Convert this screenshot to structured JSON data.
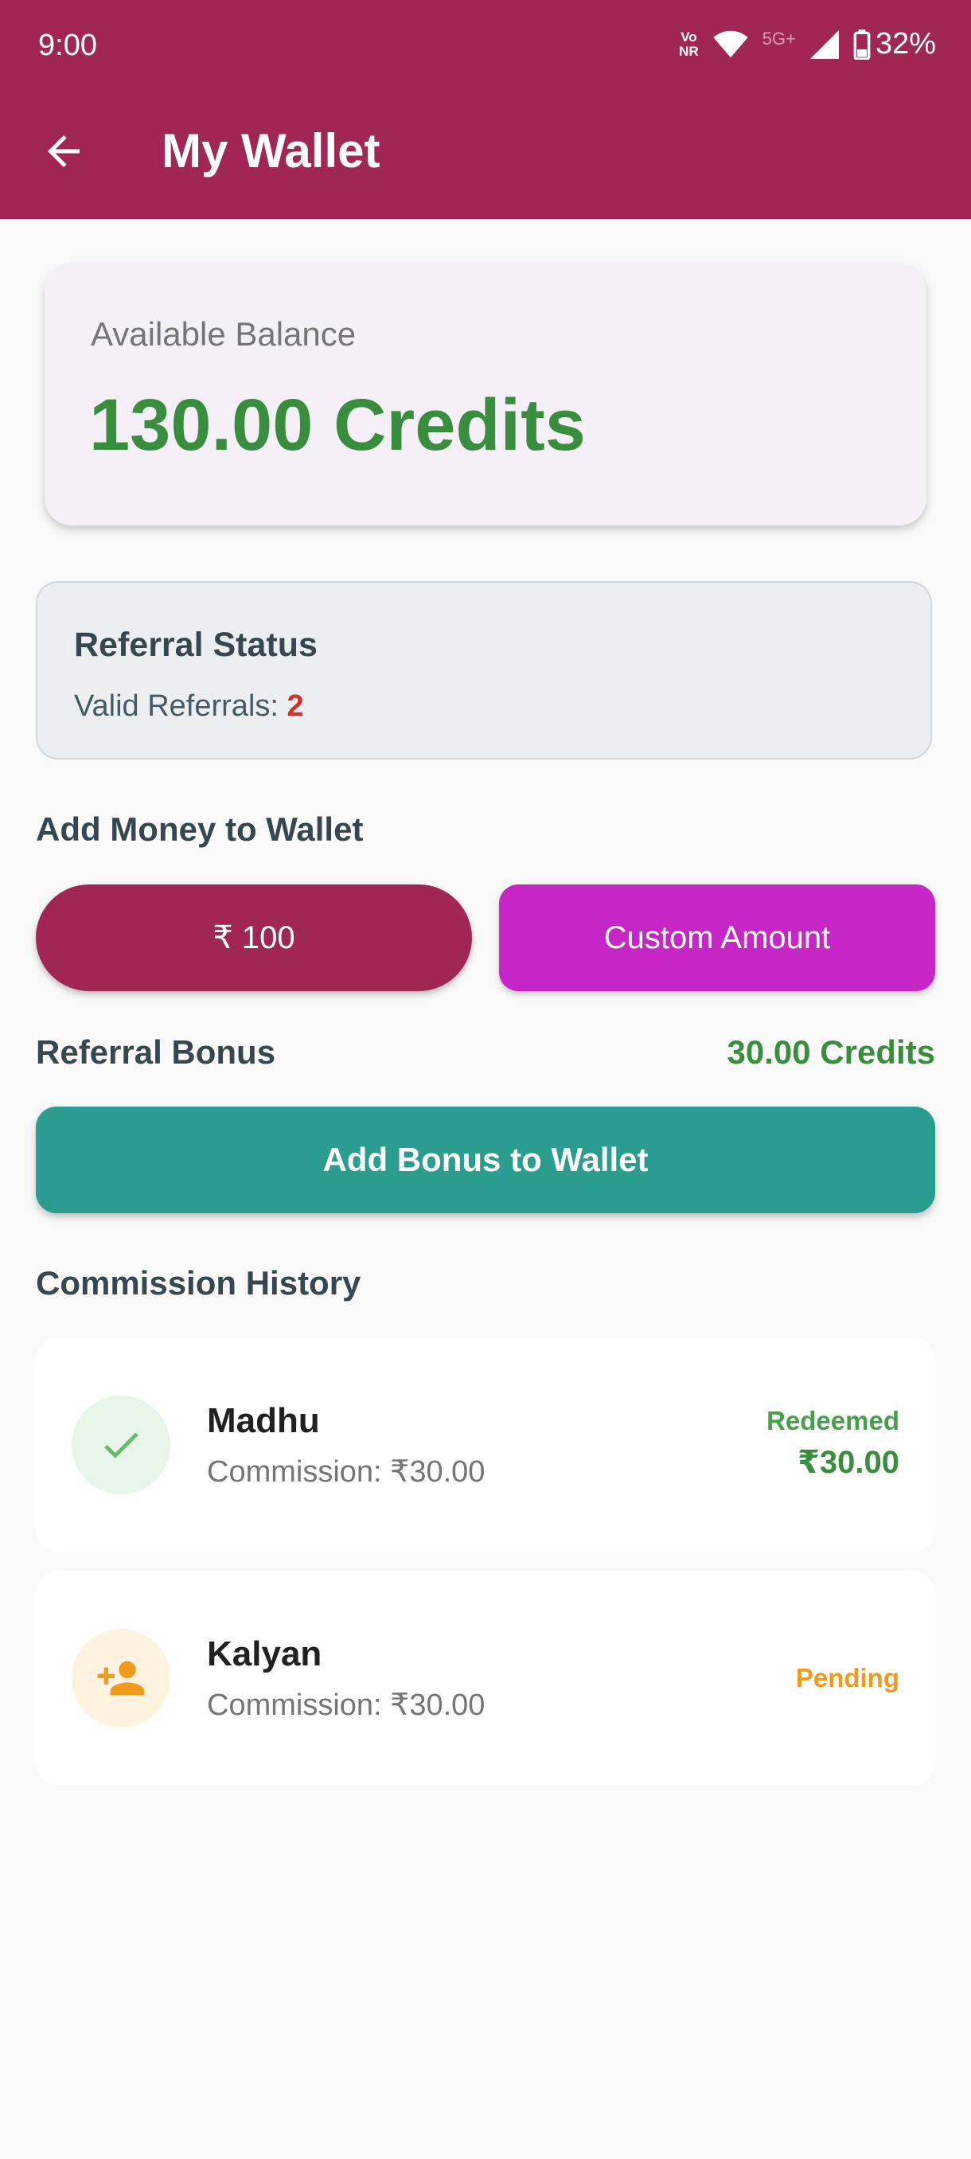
{
  "status_bar": {
    "time": "9:00",
    "volte_top": "Vo",
    "volte_bottom": "NR",
    "network": "5G+",
    "battery": "32%"
  },
  "header": {
    "title": "My Wallet"
  },
  "balance": {
    "label": "Available Balance",
    "value": "130.00 Credits"
  },
  "referral_status": {
    "title": "Referral Status",
    "valid_label": "Valid Referrals: ",
    "valid_count": "2"
  },
  "add_money": {
    "title": "Add Money to Wallet",
    "preset_button": "₹ 100",
    "custom_button": "Custom Amount"
  },
  "referral_bonus": {
    "label": "Referral Bonus",
    "value": "30.00 Credits",
    "button": "Add Bonus to Wallet"
  },
  "commission_history": {
    "title": "Commission History",
    "items": [
      {
        "name": "Madhu",
        "commission": "Commission: ₹30.00",
        "status": "Redeemed",
        "amount": "₹30.00",
        "icon": "check-icon",
        "status_color": "#43a047"
      },
      {
        "name": "Kalyan",
        "commission": "Commission: ₹30.00",
        "status": "Pending",
        "amount": "",
        "icon": "person-add-icon",
        "status_color": "#f29a1c"
      }
    ]
  },
  "colors": {
    "primary": "#a02753",
    "accent": "#c626c6",
    "teal": "#2a9d8f",
    "green": "#388e3c",
    "red": "#d32f2f"
  }
}
